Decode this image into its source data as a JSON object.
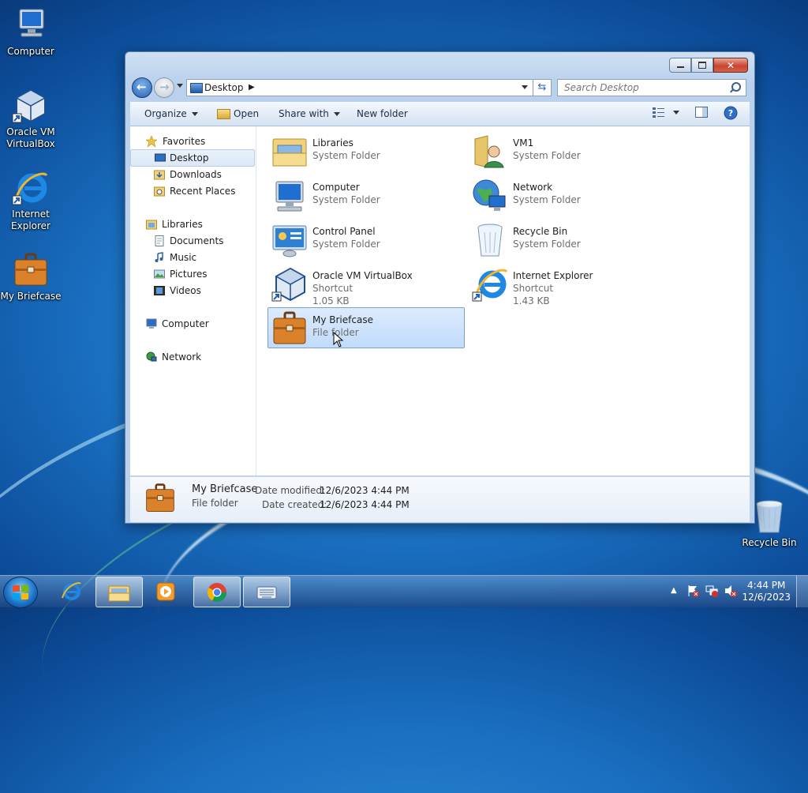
{
  "desktop": {
    "icons": [
      {
        "label": "Computer"
      },
      {
        "label": "Oracle VM VirtualBox"
      },
      {
        "label": "Internet Explorer"
      },
      {
        "label": "My Briefcase"
      },
      {
        "label": "Recycle Bin"
      }
    ]
  },
  "window": {
    "address": {
      "location": "Desktop"
    },
    "search": {
      "placeholder": "Search Desktop"
    },
    "toolbar": {
      "organize": "Organize",
      "open": "Open",
      "share_with": "Share with",
      "new_folder": "New folder"
    },
    "nav": {
      "favorites": "Favorites",
      "desktop": "Desktop",
      "downloads": "Downloads",
      "recent_places": "Recent Places",
      "libraries": "Libraries",
      "documents": "Documents",
      "music": "Music",
      "pictures": "Pictures",
      "videos": "Videos",
      "computer": "Computer",
      "network": "Network"
    },
    "items": [
      {
        "name": "Libraries",
        "type": "System Folder",
        "size": ""
      },
      {
        "name": "VM1",
        "type": "System Folder",
        "size": ""
      },
      {
        "name": "Computer",
        "type": "System Folder",
        "size": ""
      },
      {
        "name": "Network",
        "type": "System Folder",
        "size": ""
      },
      {
        "name": "Control Panel",
        "type": "System Folder",
        "size": ""
      },
      {
        "name": "Recycle Bin",
        "type": "System Folder",
        "size": ""
      },
      {
        "name": "Oracle VM VirtualBox",
        "type": "Shortcut",
        "size": "1.05 KB"
      },
      {
        "name": "Internet Explorer",
        "type": "Shortcut",
        "size": "1.43 KB"
      },
      {
        "name": "My Briefcase",
        "type": "File folder",
        "size": ""
      }
    ],
    "details": {
      "name": "My Briefcase",
      "type": "File folder",
      "modified_label": "Date modified:",
      "modified_value": "12/6/2023 4:44 PM",
      "created_label": "Date created:",
      "created_value": "12/6/2023 4:44 PM"
    }
  },
  "taskbar": {
    "time": "4:44 PM",
    "date": "12/6/2023"
  }
}
